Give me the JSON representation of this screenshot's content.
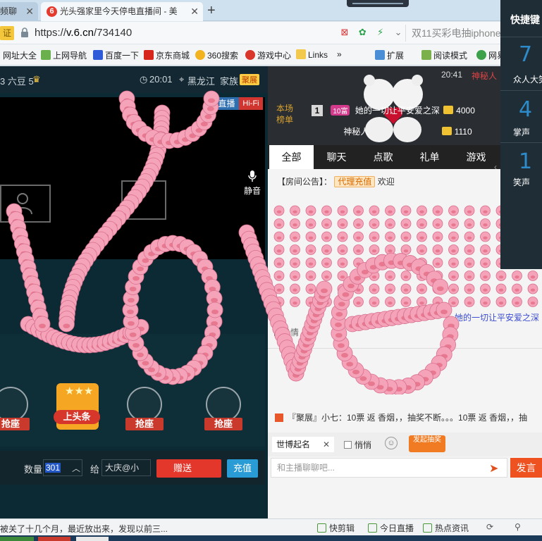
{
  "browser": {
    "tabs": [
      {
        "label": "频聊"
      },
      {
        "label": "光头强家里今天停电直播间 - 美"
      }
    ],
    "new_tab": "+",
    "cert_label": "证",
    "url_scheme": "https://",
    "url_host": "v.6.cn",
    "url_path": "/734140",
    "search_hint": "双11买彩电抽iphone",
    "bookmarks": [
      "网址大全",
      "上网导航",
      "百度一下",
      "京东商城",
      "360搜索",
      "游戏中心",
      "Links",
      "»",
      "扩展",
      "阅读模式",
      "网易"
    ]
  },
  "room": {
    "top_bar": {
      "beans": "3 六豆 5",
      "time": "20:01",
      "location": "黑龙江",
      "family_label": "家族",
      "family_badge": "聚展"
    },
    "video": {
      "live_badge": "直播",
      "hifi_badge": "Hi-Fi",
      "mute_label": "静音"
    },
    "seats": [
      "抢座",
      "抢座",
      "抢座"
    ],
    "headline_label": "上头条",
    "bottom": {
      "qty_label": "数量",
      "qty_value": "301",
      "to_label": "给",
      "to_value": "大庆@小",
      "send_label": "赠送",
      "recharge_label": "充值"
    }
  },
  "rank": {
    "time": "20:41",
    "mystery_user": "神秘人",
    "title": "本场榜单",
    "rows": [
      {
        "num": "1",
        "level": "10富",
        "name": "她的一切让平安爱之深",
        "score": "4000"
      },
      {
        "num": "",
        "level": "",
        "name": "神秘人",
        "score": "1110"
      }
    ]
  },
  "chat": {
    "tabs": [
      "全部",
      "聊天",
      "点歌",
      "礼单",
      "游戏"
    ],
    "announcement_label": "【房间公告】：",
    "agent_badge": "代理充值",
    "welcome": "欢迎",
    "line1": "她的一切让平安爱之深",
    "line2": "的热情",
    "marquee": "『聚展』小七：10票 返 香烟，，抽奖不断。。。10票 返 香烟，，抽",
    "topic_label": "世博起名",
    "whisper_label": "悄悄",
    "lottery_label": "发起抽奖",
    "input_placeholder": "和主播聊聊吧...",
    "post_label": "发言"
  },
  "shortcut": {
    "title": "快捷键",
    "items": [
      {
        "num": "7",
        "label": "众人大笑"
      },
      {
        "num": "4",
        "label": "掌声"
      },
      {
        "num": "1",
        "label": "笑声"
      }
    ]
  },
  "status": {
    "text": "被关了十几个月，最近放出来，发现以前三...",
    "items": [
      "快剪辑",
      "今日直播",
      "热点资讯"
    ]
  },
  "colors": {
    "room_bg": "#0b2a33",
    "accent_red": "#e3372b",
    "accent_orange": "#ee5220",
    "accent_blue": "#2a9cd5",
    "pig_pink": "#f4a3b9"
  },
  "icons": [
    "close-icon",
    "lock-icon",
    "plus-icon",
    "microphone-icon",
    "smile-icon",
    "send-icon",
    "crown-icon",
    "clock-icon",
    "location-icon"
  ]
}
